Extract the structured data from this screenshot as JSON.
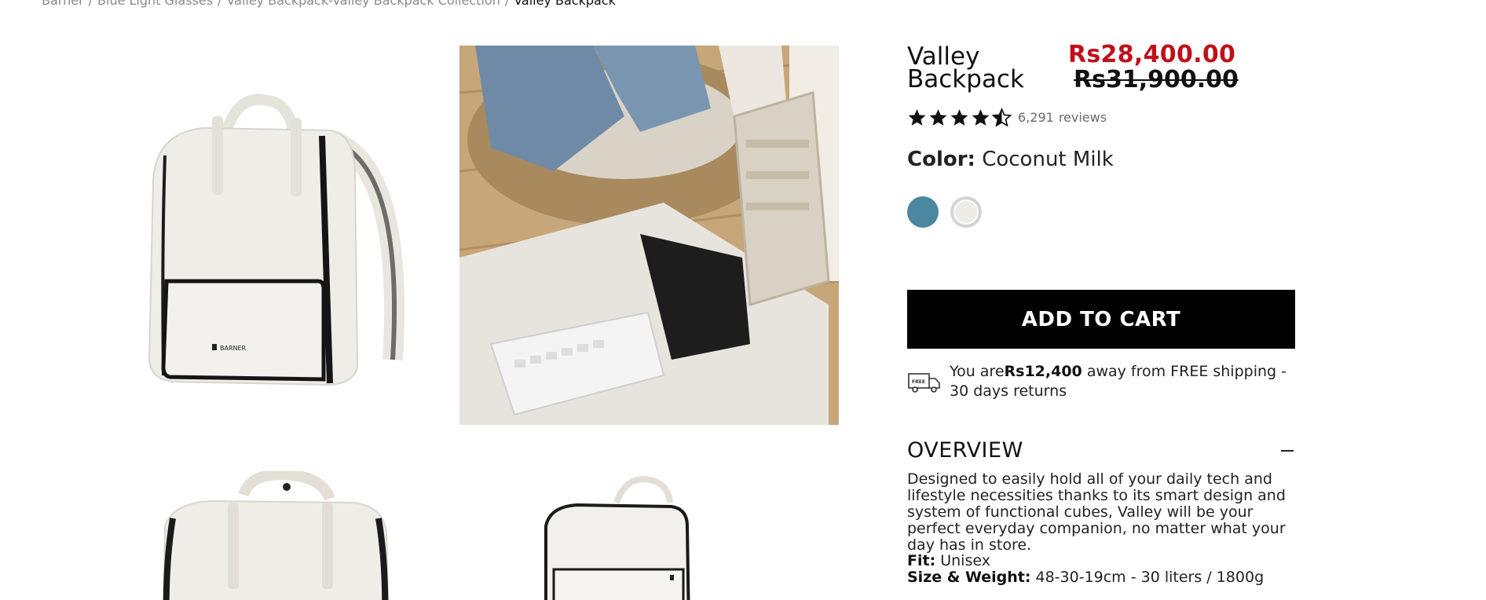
{
  "breadcrumb": {
    "items": [
      "Barner",
      "Blue Light Glasses",
      "Valley Backpack-Valley Backpack Collection"
    ],
    "current": "Valley Backpack",
    "separator": "/"
  },
  "gallery": {
    "images": [
      {
        "name": "backpack-front-white"
      },
      {
        "name": "backpack-open-lifestyle"
      },
      {
        "name": "backpack-front-white-closeup"
      },
      {
        "name": "backpack-side-white"
      }
    ]
  },
  "product": {
    "title": "Valley Backpack",
    "sale_price": "Rs28,400.00",
    "original_price": "Rs31,900.00",
    "rating": {
      "stars": 4.5,
      "max": 5,
      "count": "6,291",
      "label": "reviews"
    },
    "color_label": "Color:",
    "color_value": "Coconut Milk",
    "swatches": [
      {
        "name": "blue",
        "color": "#4b87a0"
      },
      {
        "name": "coconut-milk",
        "color": "#ecebe6"
      }
    ],
    "add_to_cart": "ADD TO CART",
    "shipping": {
      "icon": "free-truck-icon",
      "icon_text": "FREE",
      "prefix": "You are",
      "amount": "Rs12,400",
      "suffix": " away from FREE shipping - 30 days returns"
    },
    "overview": {
      "heading": "OVERVIEW",
      "text": "Designed to easily hold all of your daily tech and lifestyle necessities thanks to its smart design and system of functional cubes, Valley will be your perfect everyday companion, no matter what your day has in store.",
      "fit_label": "Fit:",
      "fit_value": "Unisex",
      "size_label": "Size & Weight:",
      "size_value": "48-30-19cm - 30 liters / 1800g"
    }
  },
  "colors": {
    "sale_red": "#c0101a",
    "button_bg": "#000000"
  }
}
